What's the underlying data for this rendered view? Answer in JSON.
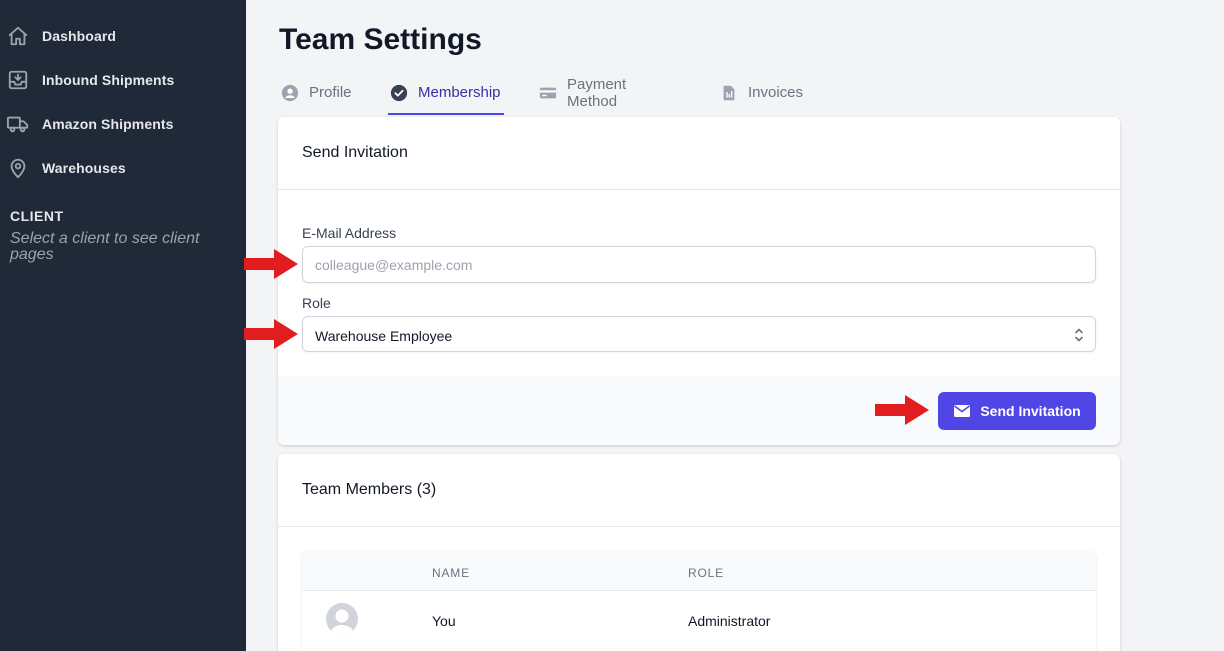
{
  "sidebar": {
    "items": [
      {
        "label": "Dashboard",
        "icon": "home-icon"
      },
      {
        "label": "Inbound Shipments",
        "icon": "inbox-in-icon"
      },
      {
        "label": "Amazon Shipments",
        "icon": "truck-icon"
      },
      {
        "label": "Warehouses",
        "icon": "location-pin-icon"
      }
    ],
    "client_heading": "CLIENT",
    "client_hint": "Select a client to see client pages"
  },
  "page": {
    "title": "Team Settings"
  },
  "tabs": [
    {
      "label": "Profile",
      "icon": "user-circle-icon",
      "active": false
    },
    {
      "label": "Membership",
      "icon": "check-circle-icon",
      "active": true
    },
    {
      "label": "Payment Method",
      "icon": "credit-card-icon",
      "active": false
    },
    {
      "label": "Invoices",
      "icon": "document-icon",
      "active": false
    }
  ],
  "invite": {
    "title": "Send Invitation",
    "email_label": "E-Mail Address",
    "email_placeholder": "colleague@example.com",
    "email_value": "",
    "role_label": "Role",
    "role_value": "Warehouse Employee",
    "send_label": "Send Invitation"
  },
  "members": {
    "title": "Team Members (3)",
    "columns": [
      "NAME",
      "ROLE"
    ],
    "rows": [
      {
        "name": "You",
        "role": "Administrator"
      }
    ]
  },
  "colors": {
    "sidebar_bg": "#1f2937",
    "accent": "#4f46e5",
    "annotation_arrow": "#e11d20"
  }
}
